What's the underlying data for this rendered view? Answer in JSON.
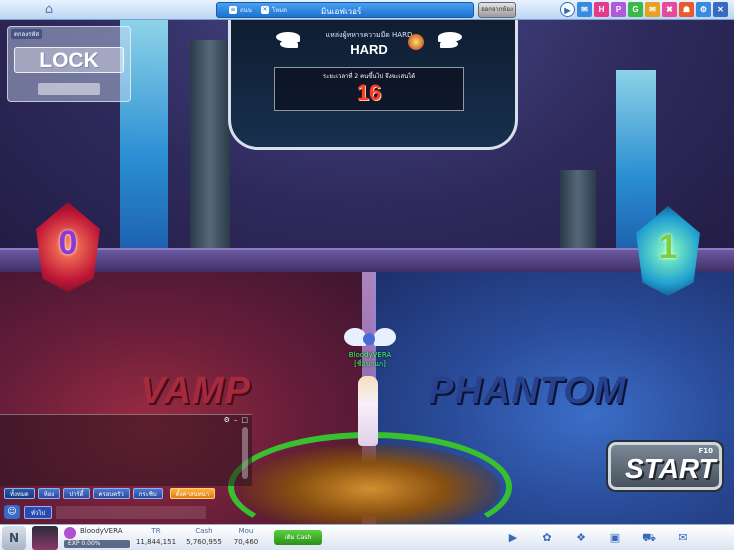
{
  "top_bar": {
    "channel_items": [
      {
        "icon": "list-icon",
        "label": "ถนน"
      },
      {
        "icon": "close-icon",
        "label": "โหมด"
      }
    ],
    "room_title": "มินเอฟเวอร์",
    "exit_label": "ออกจากห้อง",
    "icons": [
      {
        "name": "play-circle-icon",
        "label": "▶",
        "color": "#2a70c0"
      },
      {
        "name": "invite-icon",
        "label": "✉",
        "color": "#3a8ae0"
      },
      {
        "name": "hot-icon",
        "label": "H",
        "color": "#e43a8a"
      },
      {
        "name": "pet-icon",
        "label": "P",
        "color": "#b05ad8"
      },
      {
        "name": "gold-icon",
        "label": "G",
        "color": "#3ab84a"
      },
      {
        "name": "mail-icon",
        "label": "✉",
        "color": "#e8a020"
      },
      {
        "name": "event-icon",
        "label": "✖",
        "color": "#e84a9a"
      },
      {
        "name": "shop-icon",
        "label": "☗",
        "color": "#e85a30"
      },
      {
        "name": "settings-icon",
        "label": "⚙",
        "color": "#3a8ae0"
      },
      {
        "name": "close-window-icon",
        "label": "✕",
        "color": "#3a6ac0"
      }
    ]
  },
  "lock_panel": {
    "title": "ตกลงรหัส",
    "button_label": "LOCK"
  },
  "mode_banner": {
    "caption": "แหล่งผู้ทหารความมืด HARD",
    "title": "HARD",
    "note": "ระยะเวลาที่ 2 คนขึ้นไป จึงจะเล่นได้",
    "count": "16"
  },
  "teams": {
    "left": {
      "name": "VAMP",
      "number": "0",
      "color": "#a52a3e"
    },
    "right": {
      "name": "PHANTOM",
      "number": "1",
      "color": "#27418c"
    }
  },
  "character": {
    "name_line1": "BloodyVERA",
    "name_line2": "[ชื่อบานก]"
  },
  "start_button": {
    "label": "START",
    "hotkey": "F10"
  },
  "chat": {
    "controls": [
      "⚙",
      "–",
      "□"
    ],
    "tabs": [
      {
        "label": "ทั้งหมด",
        "active": true
      },
      {
        "label": "ห้อง",
        "active": false
      },
      {
        "label": "ปาร์ตี้",
        "active": false
      },
      {
        "label": "ครอบครัว",
        "active": false
      },
      {
        "label": "กระซิบ",
        "active": false
      }
    ],
    "special_tab": "ตั้งค่าสนทนา",
    "mode_label": "ทั่วไป",
    "emoji_label": "☺"
  },
  "status_bar": {
    "logo": "N",
    "player_name": "BloodyVERA",
    "exp_label": "EXP 0.00%",
    "exp_fraction": 0.0,
    "stats": [
      {
        "label": "TR",
        "value": "11,844,151"
      },
      {
        "label": "Cash",
        "value": "5,760,955"
      },
      {
        "label": "Mou",
        "value": "70,460"
      }
    ],
    "cash_button": "เติม Cash",
    "icons": [
      "play-circle-icon",
      "paw-icon",
      "wings-icon",
      "bag-icon",
      "cart-icon",
      "chat-icon"
    ]
  }
}
